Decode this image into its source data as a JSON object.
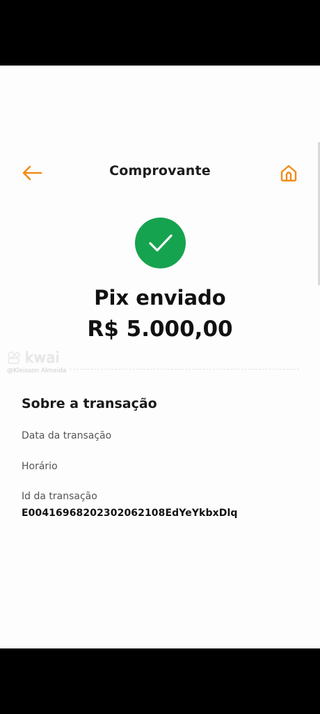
{
  "header": {
    "title": "Comprovante",
    "back_icon": "arrow-left-icon",
    "home_icon": "home-icon",
    "accent_color": "#f08c1a"
  },
  "status": {
    "icon": "check-icon",
    "icon_color": "#16a34f",
    "label": "Pix enviado",
    "amount": "R$ 5.000,00"
  },
  "transaction": {
    "section_title": "Sobre a transação",
    "fields": [
      {
        "label": "Data da transação",
        "value": ""
      },
      {
        "label": "Horário",
        "value": ""
      },
      {
        "label": "Id da transação",
        "value": "E00416968202302062108EdYeYkbxDlq"
      }
    ]
  },
  "watermark": {
    "brand": "kwai",
    "user": "@Kleisson Almeida"
  }
}
